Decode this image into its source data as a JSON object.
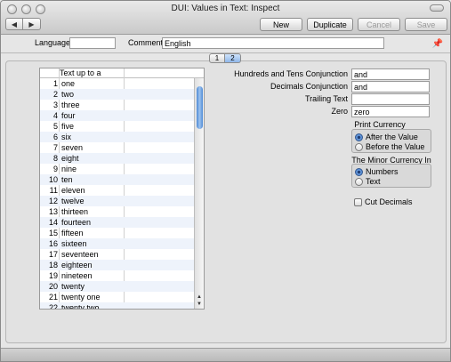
{
  "window": {
    "title": "DUI: Values in Text: Inspect"
  },
  "toolbar": {
    "new_label": "New",
    "duplicate_label": "Duplicate",
    "cancel_label": "Cancel",
    "save_label": "Save"
  },
  "header": {
    "language_label": "Language",
    "language_value": "",
    "comment_label": "Comment",
    "comment_value": "English"
  },
  "tabs": [
    "1",
    "2"
  ],
  "table": {
    "column_header": "Text up to a",
    "rows": [
      {
        "n": "1",
        "text": "one"
      },
      {
        "n": "2",
        "text": "two"
      },
      {
        "n": "3",
        "text": "three"
      },
      {
        "n": "4",
        "text": "four"
      },
      {
        "n": "5",
        "text": "five"
      },
      {
        "n": "6",
        "text": "six"
      },
      {
        "n": "7",
        "text": "seven"
      },
      {
        "n": "8",
        "text": "eight"
      },
      {
        "n": "9",
        "text": "nine"
      },
      {
        "n": "10",
        "text": "ten"
      },
      {
        "n": "11",
        "text": "eleven"
      },
      {
        "n": "12",
        "text": "twelve"
      },
      {
        "n": "13",
        "text": "thirteen"
      },
      {
        "n": "14",
        "text": "fourteen"
      },
      {
        "n": "15",
        "text": "fifteen"
      },
      {
        "n": "16",
        "text": "sixteen"
      },
      {
        "n": "17",
        "text": "seventeen"
      },
      {
        "n": "18",
        "text": "eighteen"
      },
      {
        "n": "19",
        "text": "nineteen"
      },
      {
        "n": "20",
        "text": "twenty"
      },
      {
        "n": "21",
        "text": "twenty one"
      },
      {
        "n": "22",
        "text": "twenty two"
      }
    ]
  },
  "fields": {
    "hundreds_label": "Hundreds and Tens Conjunction",
    "hundreds_value": "and",
    "decimals_label": "Decimals Conjunction",
    "decimals_value": "and",
    "trailing_label": "Trailing Text",
    "trailing_value": "",
    "zero_label": "Zero",
    "zero_value": "zero"
  },
  "print_currency": {
    "title": "Print Currency",
    "options": [
      "After the Value",
      "Before the Value"
    ],
    "selected": 0
  },
  "minor_currency": {
    "title": "The Minor Currency In",
    "options": [
      "Numbers",
      "Text"
    ],
    "selected": 0
  },
  "cut_decimals": {
    "label": "Cut Decimals",
    "checked": false
  }
}
